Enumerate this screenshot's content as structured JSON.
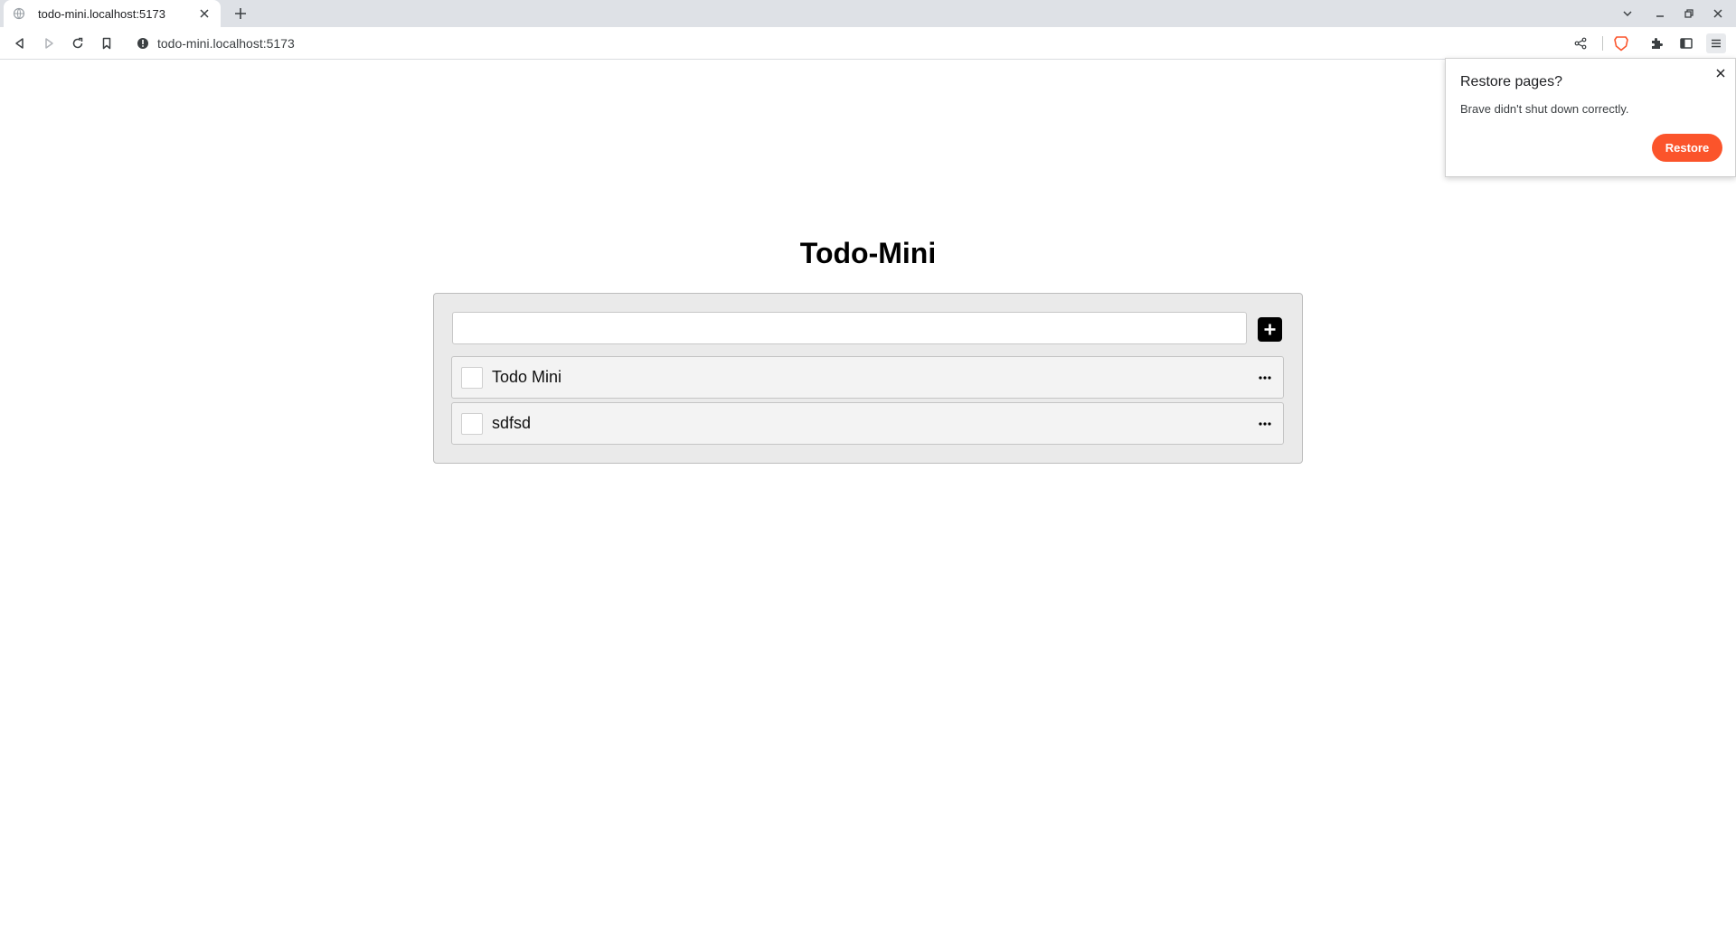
{
  "browser": {
    "tab_title": "todo-mini.localhost:5173",
    "url": "todo-mini.localhost:5173",
    "brand_color": "#fb542b"
  },
  "app": {
    "title": "Todo-Mini",
    "input_value": "",
    "items": [
      {
        "text": "Todo Mini",
        "done": false
      },
      {
        "text": "sdfsd",
        "done": false
      }
    ]
  },
  "popup": {
    "title": "Restore pages?",
    "message": "Brave didn't shut down correctly.",
    "button_label": "Restore"
  },
  "icons": {
    "tab_favicon": "globe-icon",
    "tab_close": "close-icon",
    "new_tab": "plus-icon",
    "back": "back-arrow-icon",
    "forward": "forward-arrow-icon",
    "reload": "reload-icon",
    "bookmark": "bookmark-icon",
    "site_info": "info-icon",
    "share": "share-icon",
    "brave_shields": "brave-lion-icon",
    "extensions": "puzzle-icon",
    "sidebar": "sidebar-icon",
    "menu": "hamburger-menu-icon",
    "add": "plus-icon",
    "item_menu": "more-horizontal-icon"
  }
}
